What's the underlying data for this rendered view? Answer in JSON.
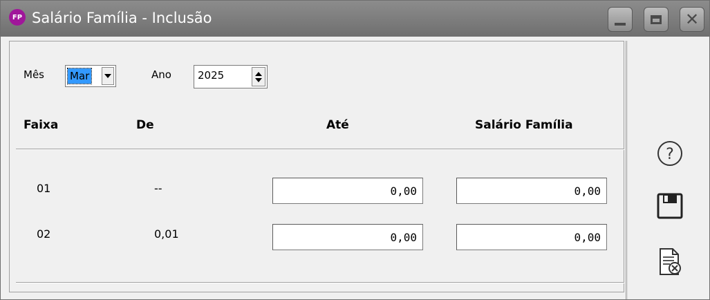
{
  "window": {
    "app_badge": "FP",
    "title": "Salário Família - Inclusão",
    "controls": {
      "minimize": "minimize-icon",
      "maximize": "maximize-icon",
      "close": "close-icon"
    }
  },
  "period": {
    "month_label": "Mês",
    "month_value": "Mar",
    "year_label": "Ano",
    "year_value": "2025"
  },
  "table": {
    "headers": {
      "faixa": "Faixa",
      "de": "De",
      "ate": "Até",
      "salario": "Salário Família"
    },
    "rows": [
      {
        "faixa": "01",
        "de": "--",
        "ate": "0,00",
        "salario": "0,00"
      },
      {
        "faixa": "02",
        "de": "0,01",
        "ate": "0,00",
        "salario": "0,00"
      }
    ]
  },
  "side_buttons": [
    "help-icon",
    "save-icon",
    "cancel-document-icon"
  ]
}
